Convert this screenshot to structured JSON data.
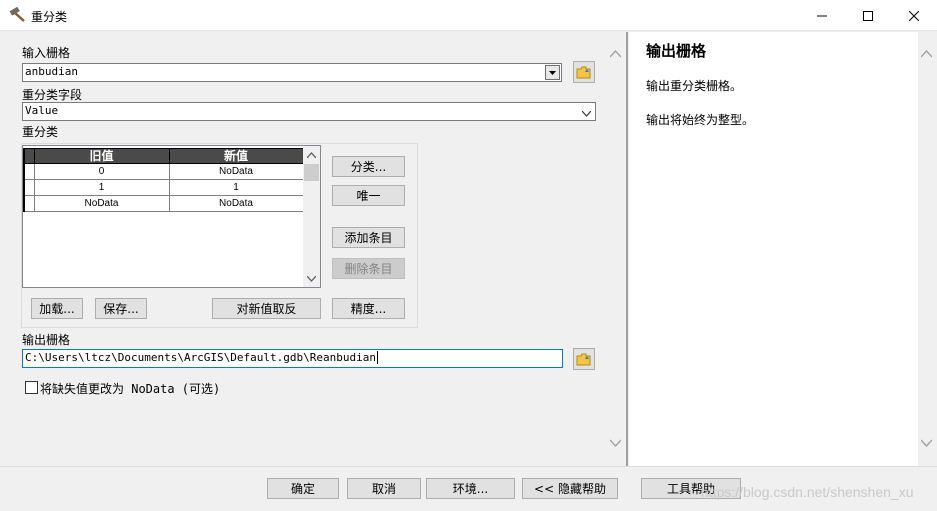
{
  "window": {
    "title": "重分类",
    "icon": "hammer-icon"
  },
  "form": {
    "input_raster_label": "输入栅格",
    "input_raster_value": "anbudian",
    "reclass_field_label": "重分类字段",
    "reclass_field_value": "Value",
    "reclass_label": "重分类",
    "table": {
      "headers": [
        "旧值",
        "新值"
      ],
      "rows": [
        {
          "old": "0",
          "new": "NoData"
        },
        {
          "old": "1",
          "new": "1"
        },
        {
          "old": "NoData",
          "new": "NoData"
        }
      ]
    },
    "side_buttons": {
      "classify": "分类...",
      "unique": "唯一",
      "add_entry": "添加条目",
      "delete_entry": "删除条目"
    },
    "bottom_buttons": {
      "load": "加载...",
      "save": "保存...",
      "reverse": "对新值取反",
      "precision": "精度..."
    },
    "output_raster_label": "输出栅格",
    "output_raster_value": "C:\\Users\\ltcz\\Documents\\ArcGIS\\Default.gdb\\Reanbudian",
    "nodata_checkbox_label": "将缺失值更改为 NoData (可选)",
    "nodata_checked": false
  },
  "help": {
    "title": "输出栅格",
    "paragraphs": [
      "输出重分类栅格。",
      "输出将始终为整型。"
    ]
  },
  "footer": {
    "ok": "确定",
    "cancel": "取消",
    "environments": "环境...",
    "hide_help": "<< 隐藏帮助",
    "tool_help": "工具帮助",
    "watermark": "https://blog.csdn.net/shenshen_xu"
  },
  "colors": {
    "grid_header": "#4a4a4a",
    "panel_bg": "#f0f0f0",
    "help_bg": "#ffffff"
  }
}
